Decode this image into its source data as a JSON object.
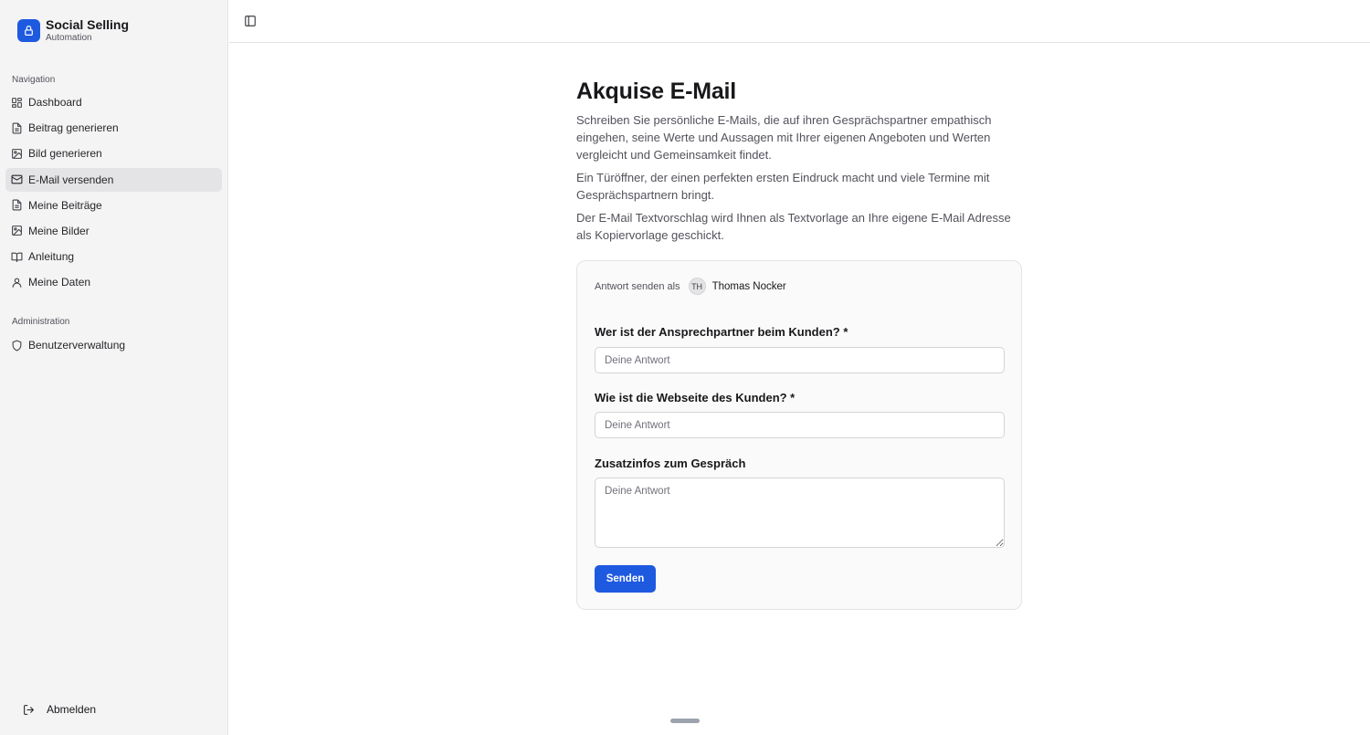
{
  "brand": {
    "title": "Social Selling",
    "subtitle": "Automation",
    "accent": "#1e5ae0"
  },
  "sidebar": {
    "navigation_label": "Navigation",
    "items": [
      {
        "label": "Dashboard",
        "icon": "grid-icon",
        "active": false
      },
      {
        "label": "Beitrag generieren",
        "icon": "document-icon",
        "active": false
      },
      {
        "label": "Bild generieren",
        "icon": "image-icon",
        "active": false
      },
      {
        "label": "E-Mail versenden",
        "icon": "mail-icon",
        "active": true
      },
      {
        "label": "Meine Beiträge",
        "icon": "document-icon",
        "active": false
      },
      {
        "label": "Meine Bilder",
        "icon": "image-icon",
        "active": false
      },
      {
        "label": "Anleitung",
        "icon": "book-icon",
        "active": false
      },
      {
        "label": "Meine Daten",
        "icon": "user-icon",
        "active": false
      }
    ],
    "administration_label": "Administration",
    "admin_items": [
      {
        "label": "Benutzerverwaltung",
        "icon": "shield-icon"
      }
    ],
    "logout_label": "Abmelden"
  },
  "page": {
    "title": "Akquise E-Mail",
    "paragraphs": [
      "Schreiben Sie persönliche E-Mails, die auf ihren Gesprächspartner empathisch eingehen, seine Werte und Aussagen mit Ihrer eigenen Angeboten und Werten vergleicht und Gemeinsamkeit findet.",
      "Ein Türöffner, der einen perfekten ersten Eindruck macht und viele Termine mit Gesprächspartnern bringt.",
      "Der E-Mail Textvorschlag wird Ihnen als Textvorlage an Ihre eigene E-Mail Adresse als Kopiervorlage geschickt."
    ]
  },
  "form": {
    "sender_label": "Antwort senden als",
    "sender_initials": "TH",
    "sender_name": "Thomas Nocker",
    "questions": [
      {
        "label": "Wer ist der Ansprechpartner beim Kunden? *",
        "placeholder": "Deine Antwort",
        "value": ""
      },
      {
        "label": "Wie ist die Webseite des Kunden? *",
        "placeholder": "Deine Antwort",
        "value": ""
      },
      {
        "label": "Zusatzinfos zum Gespräch",
        "placeholder": "Deine Antwort",
        "value": ""
      }
    ],
    "submit_label": "Senden"
  }
}
